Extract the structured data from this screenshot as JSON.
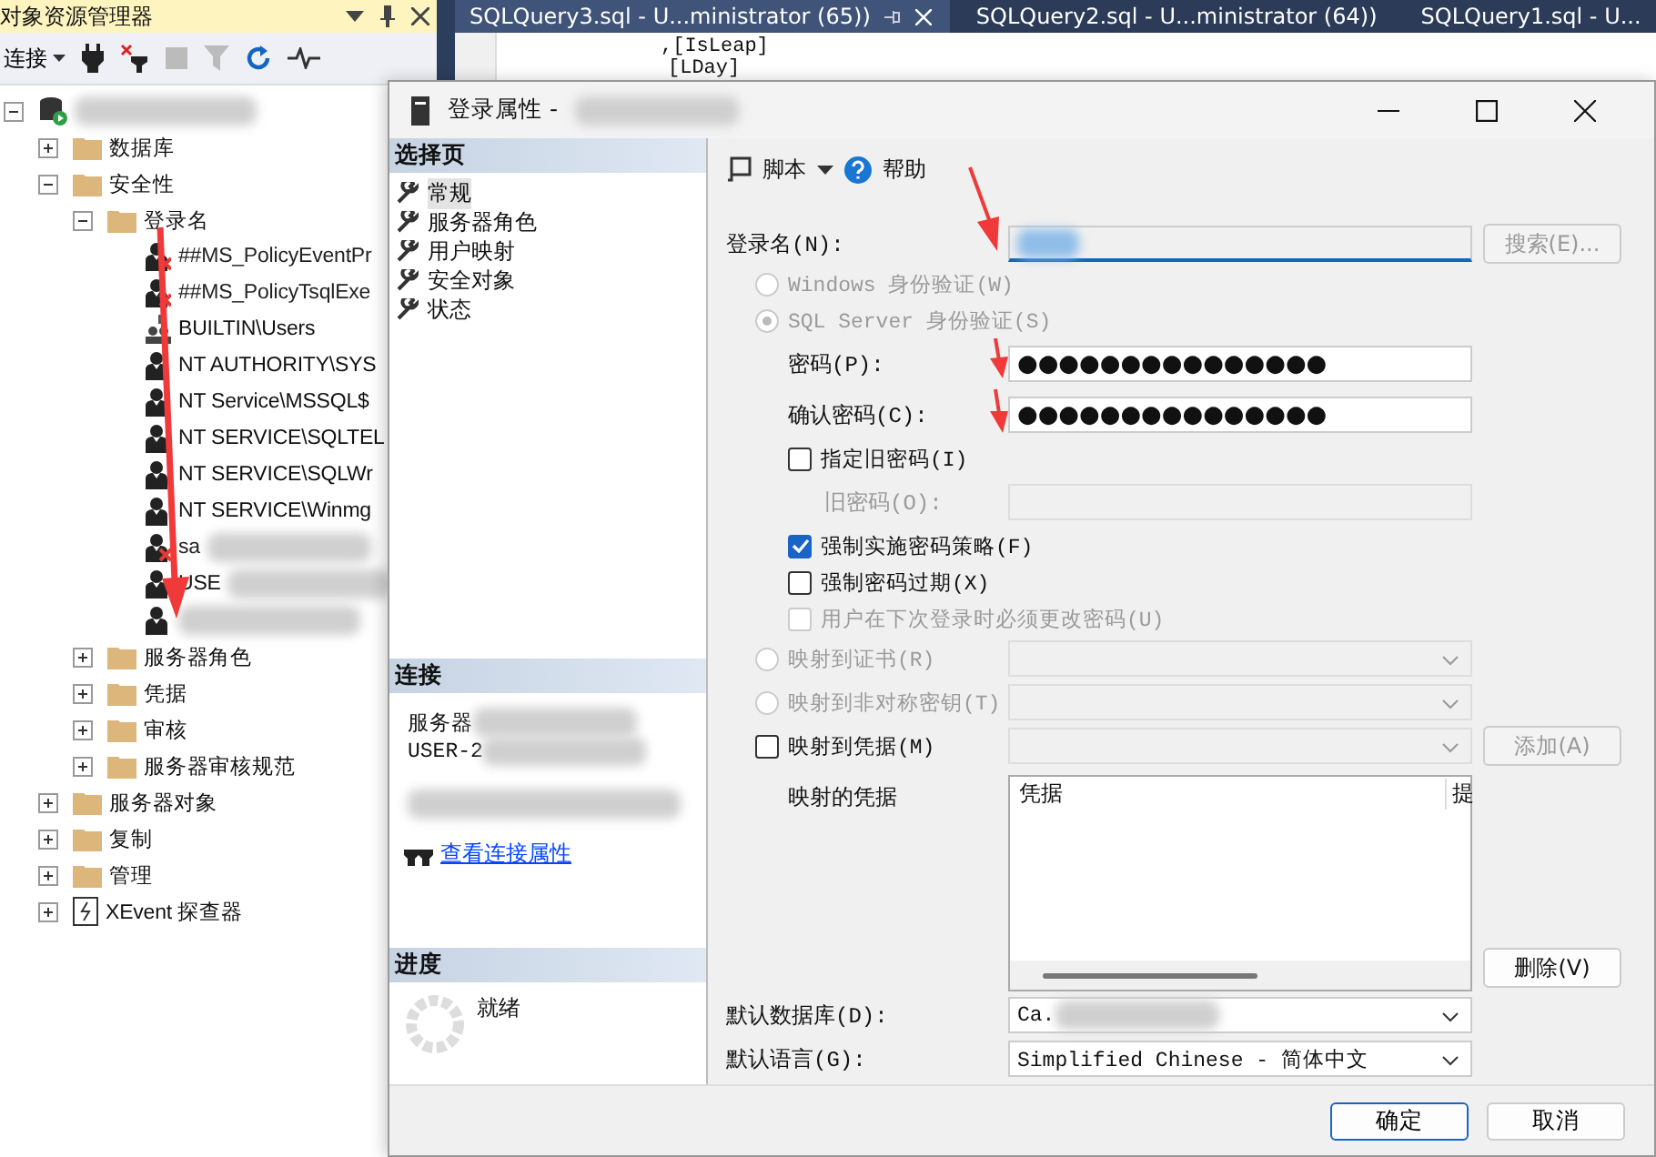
{
  "editor": {
    "tabs": [
      {
        "label": "SQLQuery3.sql - U...ministrator (65))",
        "selected": true
      },
      {
        "label": "SQLQuery2.sql - U...ministrator (64))",
        "selected": false
      },
      {
        "label": "SQLQuery1.sql - U...",
        "selected": false
      }
    ],
    "lines": [
      ",[IsLeap]",
      "[LDay]"
    ]
  },
  "explorer": {
    "title": "对象资源管理器",
    "connect": "连接",
    "tree": [
      {
        "kind": "server",
        "expanded": true,
        "children": [
          {
            "kind": "folder",
            "label": "数据库",
            "expanded": false
          },
          {
            "kind": "folder",
            "label": "安全性",
            "expanded": true,
            "children": [
              {
                "kind": "folder",
                "label": "登录名",
                "expanded": true,
                "children": [
                  {
                    "kind": "login",
                    "label": "##MS_PolicyEventPr",
                    "disabled": true
                  },
                  {
                    "kind": "login",
                    "label": "##MS_PolicyTsqlExe",
                    "disabled": true
                  },
                  {
                    "kind": "group",
                    "label": "BUILTIN\\Users",
                    "disabled": false
                  },
                  {
                    "kind": "login",
                    "label": "NT AUTHORITY\\SYS",
                    "disabled": false
                  },
                  {
                    "kind": "login",
                    "label": "NT Service\\MSSQL$",
                    "disabled": false
                  },
                  {
                    "kind": "login",
                    "label": "NT SERVICE\\SQLTEL",
                    "disabled": false
                  },
                  {
                    "kind": "login",
                    "label": "NT SERVICE\\SQLWr",
                    "disabled": false
                  },
                  {
                    "kind": "login",
                    "label": "NT SERVICE\\Winmg",
                    "disabled": false
                  },
                  {
                    "kind": "login",
                    "label": "sa",
                    "disabled": true
                  },
                  {
                    "kind": "login",
                    "label": "USE",
                    "disabled": false
                  },
                  {
                    "kind": "login",
                    "disabled": false
                  }
                ]
              },
              {
                "kind": "folder",
                "label": "服务器角色",
                "expanded": false
              },
              {
                "kind": "folder",
                "label": "凭据",
                "expanded": false
              },
              {
                "kind": "folder",
                "label": "审核",
                "expanded": false
              },
              {
                "kind": "folder",
                "label": "服务器审核规范",
                "expanded": false
              }
            ]
          },
          {
            "kind": "folder",
            "label": "服务器对象",
            "expanded": false
          },
          {
            "kind": "folder",
            "label": "复制",
            "expanded": false
          },
          {
            "kind": "folder",
            "label": "管理",
            "expanded": false
          },
          {
            "kind": "xevent",
            "label": "XEvent 探查器",
            "expanded": false
          }
        ]
      }
    ]
  },
  "dialog": {
    "title": "登录属性 -",
    "pages_title": "选择页",
    "pages": [
      {
        "label": "常规",
        "selected": true
      },
      {
        "label": "服务器角色",
        "selected": false
      },
      {
        "label": "用户映射",
        "selected": false
      },
      {
        "label": "安全对象",
        "selected": false
      },
      {
        "label": "状态",
        "selected": false
      }
    ],
    "connection": {
      "title": "连接",
      "server_label": "服务器",
      "server_value": "USER-2",
      "link": "查看连接属性"
    },
    "progress": {
      "title": "进度",
      "status": "就绪"
    },
    "toolbar": {
      "script": "脚本",
      "help": "帮助"
    },
    "form": {
      "login": {
        "label": "登录名(N):",
        "search": "搜索(E)...",
        "search_disabled": true
      },
      "auth": [
        {
          "label": "Windows 身份验证(W)",
          "selected": false,
          "disabled": true
        },
        {
          "label": "SQL Server 身份验证(S)",
          "selected": true,
          "disabled": true
        }
      ],
      "password": {
        "label": "密码(P):",
        "value": "●●●●●●●●●●●●●●●"
      },
      "confirm": {
        "label": "确认密码(C):",
        "value": "●●●●●●●●●●●●●●●"
      },
      "old_check": {
        "label": "指定旧密码(I)",
        "checked": false
      },
      "old_password": {
        "label": "旧密码(O):",
        "disabled": true
      },
      "policy": [
        {
          "label": "强制实施密码策略(F)",
          "checked": true,
          "disabled": false
        },
        {
          "label": "强制密码过期(X)",
          "checked": false,
          "disabled": false
        },
        {
          "label": "用户在下次登录时必须更改密码(U)",
          "checked": false,
          "disabled": true
        }
      ],
      "mapping": [
        {
          "kind": "radio",
          "label": "映射到证书(R)",
          "selected": false,
          "disabled": true
        },
        {
          "kind": "radio",
          "label": "映射到非对称密钥(T)",
          "selected": false,
          "disabled": true
        },
        {
          "kind": "checkbox",
          "label": "映射到凭据(M)",
          "checked": false,
          "disabled": false,
          "button": "添加(A)",
          "button_disabled": true
        }
      ],
      "credentials": {
        "label": "映射的凭据",
        "columns": [
          "凭据",
          "提"
        ],
        "remove": "删除(V)"
      },
      "default_db": {
        "label": "默认数据库(D):",
        "value": "Ca."
      },
      "default_language": {
        "label": "默认语言(G):",
        "value": "Simplified Chinese - 简体中文"
      }
    },
    "buttons": [
      {
        "label": "确定",
        "default": true
      },
      {
        "label": "取消",
        "default": false
      }
    ]
  }
}
